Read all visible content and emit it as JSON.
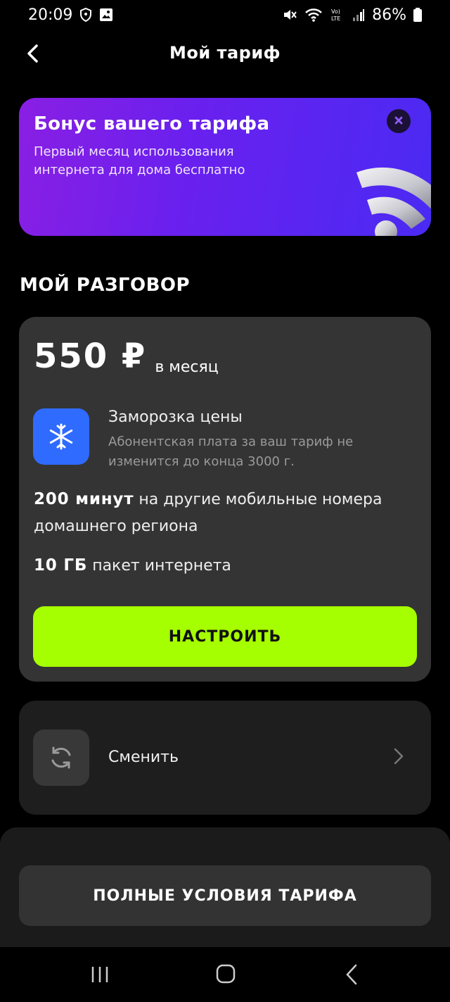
{
  "status_bar": {
    "time": "20:09",
    "battery": "86%",
    "icons": [
      "shield-icon",
      "image-icon",
      "mute-icon",
      "wifi-icon",
      "volte-icon",
      "signal-icon",
      "battery-icon"
    ]
  },
  "header": {
    "title": "Мой тариф",
    "back_icon": "chevron-left-icon"
  },
  "bonus_banner": {
    "title": "Бонус вашего тарифа",
    "text": "Первый месяц использования интернета для дома бесплатно",
    "close_icon": "close-icon",
    "illustration": "wifi-3d-icon"
  },
  "section_title": "МОЙ РАЗГОВОР",
  "tariff": {
    "price": "550 ₽",
    "period": "в месяц",
    "freeze": {
      "icon": "snowflake-icon",
      "title": "Заморозка цены",
      "description": "Абонентская плата за ваш тариф не изменится до конца 3000 г."
    },
    "features": [
      {
        "value": "200 минут",
        "text": " на другие мобильные номера домашнего региона"
      },
      {
        "value": "10 ГБ",
        "text": " пакет интернета"
      }
    ],
    "configure_button": "НАСТРОИТЬ"
  },
  "change": {
    "icon": "refresh-icon",
    "label": "Сменить",
    "chevron": "chevron-right-icon"
  },
  "bottom": {
    "full_terms_button": "ПОЛНЫЕ УСЛОВИЯ ТАРИФА"
  },
  "nav_bar": {
    "icons": [
      "recent-apps-icon",
      "home-icon",
      "back-icon"
    ]
  },
  "colors": {
    "background": "#000000",
    "banner_gradient_start": "#8a1fe3",
    "banner_gradient_end": "#4a2af3",
    "card": "#343434",
    "accent_green": "#a6ff00",
    "freeze_blue": "#2f6bff"
  }
}
